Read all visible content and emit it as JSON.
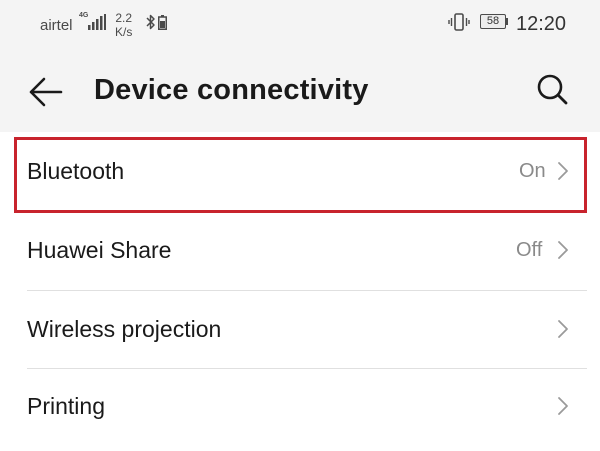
{
  "status_bar": {
    "carrier": "airtel",
    "network_type": "4G",
    "speed_value": "2.2",
    "speed_unit": "K/s",
    "battery_level": "58",
    "time": "12:20"
  },
  "header": {
    "title": "Device connectivity",
    "back_icon": "arrow-left-icon",
    "search_icon": "search-icon"
  },
  "settings": [
    {
      "label": "Bluetooth",
      "value": "On",
      "highlighted": true
    },
    {
      "label": "Huawei Share",
      "value": "Off",
      "highlighted": false
    },
    {
      "label": "Wireless projection",
      "value": "",
      "highlighted": false
    },
    {
      "label": "Printing",
      "value": "",
      "highlighted": false
    }
  ],
  "colors": {
    "header_background": "#f4f4f4",
    "highlight_border": "#c8232d",
    "secondary_text": "#8a8a8a"
  }
}
